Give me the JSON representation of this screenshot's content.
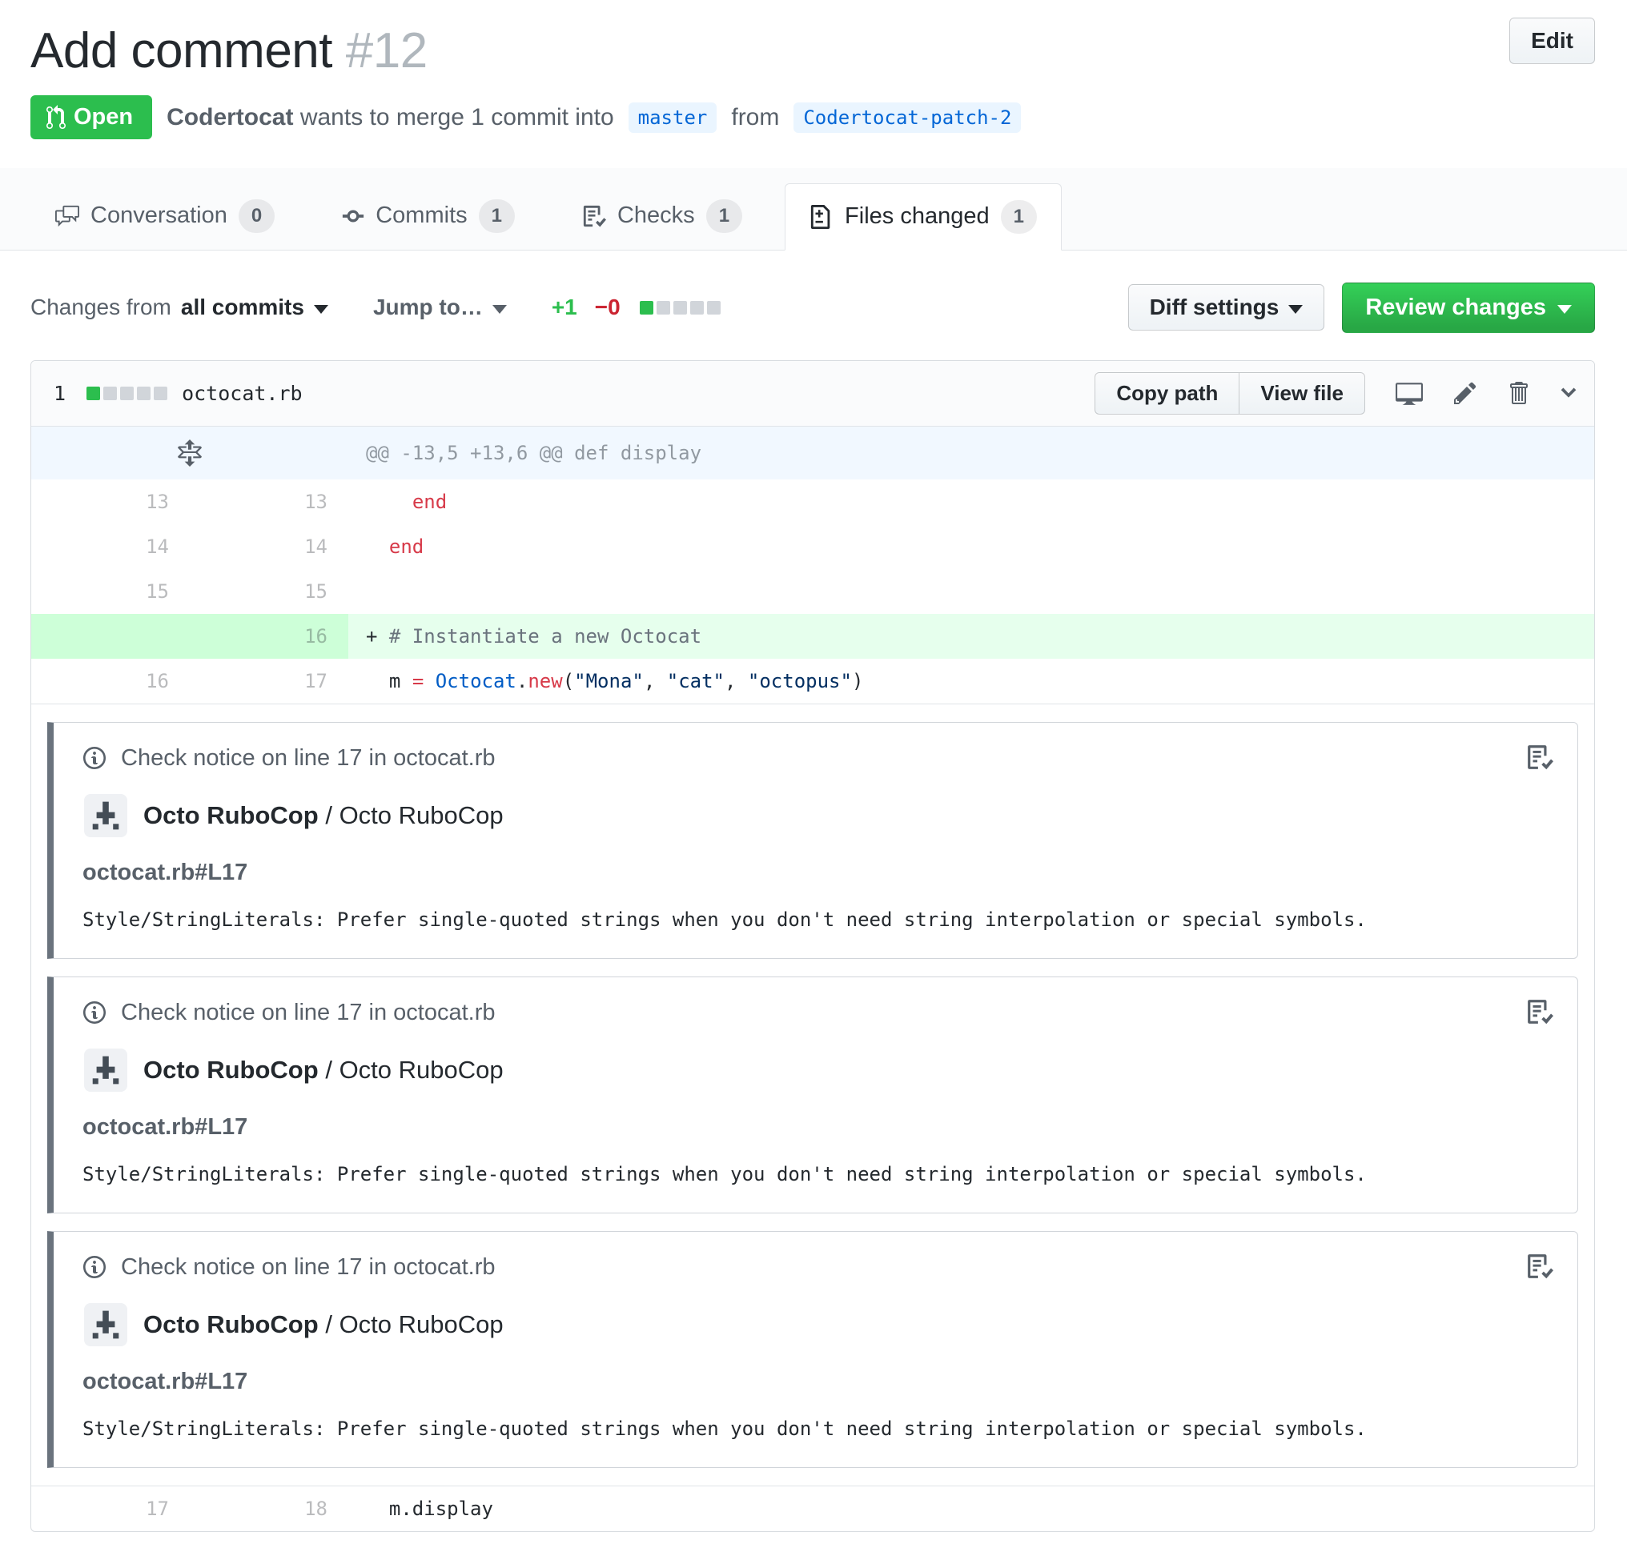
{
  "header": {
    "title": "Add comment",
    "number": "#12",
    "edit_label": "Edit",
    "state_label": "Open",
    "author": "Codertocat",
    "merge_text": "wants to merge 1 commit into",
    "base_branch": "master",
    "from_word": "from",
    "head_branch": "Codertocat-patch-2"
  },
  "tabs": [
    {
      "label": "Conversation",
      "count": "0"
    },
    {
      "label": "Commits",
      "count": "1"
    },
    {
      "label": "Checks",
      "count": "1"
    },
    {
      "label": "Files changed",
      "count": "1"
    }
  ],
  "diffbar": {
    "changes_from": "Changes from",
    "commit_range": "all commits",
    "jump_to": "Jump to…",
    "additions": "+1",
    "deletions": "−0",
    "diff_settings": "Diff settings",
    "review_changes": "Review changes"
  },
  "file": {
    "changed_count": "1",
    "name": "octocat.rb",
    "copy_path": "Copy path",
    "view_file": "View file",
    "hunk": "@@ -13,5 +13,6 @@ def display",
    "lines": [
      {
        "old": "13",
        "new": "13",
        "sign": "  ",
        "segments": [
          {
            "text": "  ",
            "type": "p"
          },
          {
            "text": "end",
            "type": "k"
          }
        ]
      },
      {
        "old": "14",
        "new": "14",
        "sign": "  ",
        "segments": [
          {
            "text": "end",
            "type": "k"
          }
        ]
      },
      {
        "old": "15",
        "new": "15",
        "sign": "  ",
        "segments": []
      },
      {
        "old": "",
        "new": "16",
        "sign": "+ ",
        "added": true,
        "segments": [
          {
            "text": "# Instantiate a new Octocat",
            "type": "cm"
          }
        ]
      },
      {
        "old": "16",
        "new": "17",
        "sign": "  ",
        "segments": [
          {
            "text": "m ",
            "type": "p"
          },
          {
            "text": "=",
            "type": "k"
          },
          {
            "text": " ",
            "type": "p"
          },
          {
            "text": "Octocat",
            "type": "c"
          },
          {
            "text": ".",
            "type": "p"
          },
          {
            "text": "new",
            "type": "k"
          },
          {
            "text": "(",
            "type": "p"
          },
          {
            "text": "\"Mona\"",
            "type": "s"
          },
          {
            "text": ", ",
            "type": "p"
          },
          {
            "text": "\"cat\"",
            "type": "s"
          },
          {
            "text": ", ",
            "type": "p"
          },
          {
            "text": "\"octopus\"",
            "type": "s"
          },
          {
            "text": ")",
            "type": "p"
          }
        ]
      },
      {
        "old": "17",
        "new": "18",
        "sign": "  ",
        "segments": [
          {
            "text": "m.display",
            "type": "p"
          }
        ]
      }
    ]
  },
  "notices": [
    {
      "header": "Check notice on line 17 in octocat.rb",
      "app_name": "Octo RuboCop",
      "separator": "/",
      "context": "Octo RuboCop",
      "file_ref": "octocat.rb#L17",
      "message": "Style/StringLiterals: Prefer single-quoted strings when you don't need string interpolation or special symbols."
    },
    {
      "header": "Check notice on line 17 in octocat.rb",
      "app_name": "Octo RuboCop",
      "separator": "/",
      "context": "Octo RuboCop",
      "file_ref": "octocat.rb#L17",
      "message": "Style/StringLiterals: Prefer single-quoted strings when you don't need string interpolation or special symbols."
    },
    {
      "header": "Check notice on line 17 in octocat.rb",
      "app_name": "Octo RuboCop",
      "separator": "/",
      "context": "Octo RuboCop",
      "file_ref": "octocat.rb#L17",
      "message": "Style/StringLiterals: Prefer single-quoted strings when you don't need string interpolation or special symbols."
    }
  ]
}
